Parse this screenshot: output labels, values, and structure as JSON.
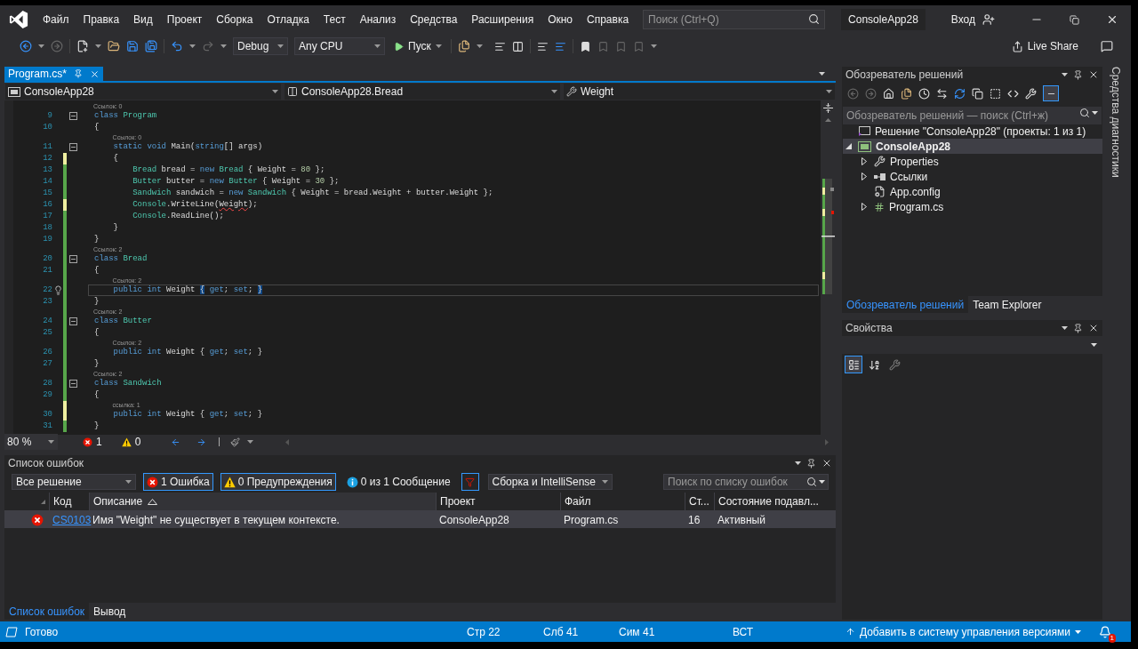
{
  "window": {
    "title": "ConsoleApp28",
    "search_placeholder": "Поиск (Ctrl+Q)",
    "sign_in": "Вход"
  },
  "menu": [
    "Файл",
    "Правка",
    "Вид",
    "Проект",
    "Сборка",
    "Отладка",
    "Тест",
    "Анализ",
    "Средства",
    "Расширения",
    "Окно",
    "Справка"
  ],
  "toolbar": {
    "configuration": "Debug",
    "platform": "Any CPU",
    "start": "Пуск",
    "live_share": "Live Share"
  },
  "editor": {
    "tabs": [
      {
        "label": "Program.cs*",
        "selected": true
      }
    ],
    "nav": [
      "ConsoleApp28",
      "ConsoleApp28.Bread",
      "Weight"
    ],
    "lines": [
      {
        "num": "9",
        "lens": "Ссылок: 0",
        "fold": true,
        "kind": "unchanged",
        "current": false,
        "lightbulb": false,
        "tokens": [
          {
            "t": "class ",
            "kind": "keyword"
          },
          {
            "t": "Program",
            "kind": "type"
          }
        ]
      },
      {
        "num": "10",
        "fold": false,
        "kind": "unchanged",
        "current": false,
        "lightbulb": false,
        "tokens": [
          {
            "t": "{",
            "kind": "text"
          }
        ]
      },
      {
        "num": "11",
        "lens": "Ссылок: 0",
        "fold": true,
        "kind": "unchanged",
        "current": false,
        "lightbulb": false,
        "tokens": [
          {
            "t": "    static ",
            "kind": "keyword"
          },
          {
            "t": "void",
            "kind": "keyword"
          },
          {
            "t": " Main(",
            "kind": "text"
          },
          {
            "t": "string",
            "kind": "keyword"
          },
          {
            "t": "[] args)",
            "kind": "text"
          }
        ]
      },
      {
        "num": "12",
        "fold": false,
        "kind": "unsaved",
        "current": false,
        "lightbulb": false,
        "tokens": [
          {
            "t": "    {",
            "kind": "text"
          }
        ]
      },
      {
        "num": "13",
        "fold": false,
        "kind": "saved",
        "current": false,
        "lightbulb": false,
        "tokens": [
          {
            "t": "        Bread",
            "kind": "type"
          },
          {
            "t": " bread = ",
            "kind": "text"
          },
          {
            "t": "new ",
            "kind": "keyword"
          },
          {
            "t": "Bread",
            "kind": "type"
          },
          {
            "t": " { Weight = ",
            "kind": "text"
          },
          {
            "t": "80",
            "kind": "number"
          },
          {
            "t": " };",
            "kind": "text"
          }
        ]
      },
      {
        "num": "14",
        "fold": false,
        "kind": "saved",
        "current": false,
        "lightbulb": false,
        "tokens": [
          {
            "t": "        Butter",
            "kind": "type"
          },
          {
            "t": " butter = ",
            "kind": "text"
          },
          {
            "t": "new ",
            "kind": "keyword"
          },
          {
            "t": "Butter",
            "kind": "type"
          },
          {
            "t": " { Weight = ",
            "kind": "text"
          },
          {
            "t": "30",
            "kind": "number"
          },
          {
            "t": " };",
            "kind": "text"
          }
        ]
      },
      {
        "num": "15",
        "fold": false,
        "kind": "saved",
        "current": false,
        "lightbulb": false,
        "tokens": [
          {
            "t": "        Sandwich",
            "kind": "type"
          },
          {
            "t": " sandwich = ",
            "kind": "text"
          },
          {
            "t": "new ",
            "kind": "keyword"
          },
          {
            "t": "Sandwich",
            "kind": "type"
          },
          {
            "t": " { Weight = bread.Weight + butter.Weight };",
            "kind": "text"
          }
        ]
      },
      {
        "num": "16",
        "fold": false,
        "kind": "unsaved",
        "current": false,
        "lightbulb": false,
        "tokens": [
          {
            "t": "        Console",
            "kind": "type"
          },
          {
            "t": ".WriteLine(",
            "kind": "text"
          },
          {
            "t": "Weight",
            "kind": "text",
            "error": true
          },
          {
            "t": ");",
            "kind": "text"
          }
        ]
      },
      {
        "num": "17",
        "fold": false,
        "kind": "saved",
        "current": false,
        "lightbulb": false,
        "tokens": [
          {
            "t": "        Console",
            "kind": "type"
          },
          {
            "t": ".ReadLine();",
            "kind": "text"
          }
        ]
      },
      {
        "num": "18",
        "fold": false,
        "kind": "saved",
        "current": false,
        "lightbulb": false,
        "tokens": [
          {
            "t": "    }",
            "kind": "text"
          }
        ]
      },
      {
        "num": "19",
        "fold": false,
        "kind": "saved",
        "current": false,
        "lightbulb": false,
        "tokens": [
          {
            "t": "}",
            "kind": "text"
          }
        ]
      },
      {
        "num": "20",
        "lens": "Ссылок: 2",
        "fold": true,
        "kind": "saved",
        "current": false,
        "lightbulb": false,
        "tokens": [
          {
            "t": "class ",
            "kind": "keyword"
          },
          {
            "t": "Bread",
            "kind": "type"
          }
        ]
      },
      {
        "num": "21",
        "fold": false,
        "kind": "saved",
        "current": false,
        "lightbulb": false,
        "tokens": [
          {
            "t": "{",
            "kind": "text"
          }
        ]
      },
      {
        "num": "22",
        "lens": "Ссылок: 2",
        "fold": false,
        "kind": "saved",
        "current": true,
        "lightbulb": true,
        "tokens": [
          {
            "t": "    public ",
            "kind": "keyword"
          },
          {
            "t": "int",
            "kind": "keyword"
          },
          {
            "t": " Weight ",
            "kind": "text"
          },
          {
            "t": "{",
            "kind": "text",
            "match": true
          },
          {
            "t": " get",
            "kind": "keyword"
          },
          {
            "t": "; ",
            "kind": "text"
          },
          {
            "t": "set",
            "kind": "keyword"
          },
          {
            "t": "; ",
            "kind": "text"
          },
          {
            "t": "}",
            "kind": "text",
            "match": true
          }
        ]
      },
      {
        "num": "23",
        "fold": false,
        "kind": "saved",
        "current": false,
        "lightbulb": false,
        "tokens": [
          {
            "t": "}",
            "kind": "text"
          }
        ]
      },
      {
        "num": "24",
        "lens": "Ссылок: 2",
        "fold": true,
        "kind": "saved",
        "current": false,
        "lightbulb": false,
        "tokens": [
          {
            "t": "class ",
            "kind": "keyword"
          },
          {
            "t": "Butter",
            "kind": "type"
          }
        ]
      },
      {
        "num": "25",
        "fold": false,
        "kind": "saved",
        "current": false,
        "lightbulb": false,
        "tokens": [
          {
            "t": "{",
            "kind": "text"
          }
        ]
      },
      {
        "num": "26",
        "lens": "Ссылок: 2",
        "fold": false,
        "kind": "saved",
        "current": false,
        "lightbulb": false,
        "tokens": [
          {
            "t": "    public ",
            "kind": "keyword"
          },
          {
            "t": "int",
            "kind": "keyword"
          },
          {
            "t": " Weight { ",
            "kind": "text"
          },
          {
            "t": "get",
            "kind": "keyword"
          },
          {
            "t": "; ",
            "kind": "text"
          },
          {
            "t": "set",
            "kind": "keyword"
          },
          {
            "t": "; }",
            "kind": "text"
          }
        ]
      },
      {
        "num": "27",
        "fold": false,
        "kind": "saved",
        "current": false,
        "lightbulb": false,
        "tokens": [
          {
            "t": "}",
            "kind": "text"
          }
        ]
      },
      {
        "num": "28",
        "lens": "Ссылок: 2",
        "fold": true,
        "kind": "saved",
        "current": false,
        "lightbulb": false,
        "tokens": [
          {
            "t": "class ",
            "kind": "keyword"
          },
          {
            "t": "Sandwich",
            "kind": "type"
          }
        ]
      },
      {
        "num": "29",
        "fold": false,
        "kind": "saved",
        "current": false,
        "lightbulb": false,
        "tokens": [
          {
            "t": "{",
            "kind": "text"
          }
        ]
      },
      {
        "num": "30",
        "lens": "ссылка: 1",
        "fold": false,
        "kind": "unsaved",
        "current": false,
        "lightbulb": false,
        "tokens": [
          {
            "t": "    public ",
            "kind": "keyword"
          },
          {
            "t": "int",
            "kind": "keyword"
          },
          {
            "t": " Weight { ",
            "kind": "text"
          },
          {
            "t": "get",
            "kind": "keyword"
          },
          {
            "t": "; ",
            "kind": "text"
          },
          {
            "t": "set",
            "kind": "keyword"
          },
          {
            "t": "; }",
            "kind": "text"
          }
        ]
      },
      {
        "num": "31",
        "fold": false,
        "kind": "saved",
        "current": false,
        "lightbulb": false,
        "tokens": [
          {
            "t": "}",
            "kind": "text"
          }
        ]
      }
    ],
    "zoom": "80 %",
    "errors": "1",
    "warnings": "0"
  },
  "error_list": {
    "title": "Список ошибок",
    "scope": "Все решение",
    "filters": [
      {
        "kind": "error",
        "label": "1 Ошибка",
        "selected": true
      },
      {
        "kind": "warning",
        "label": "0 Предупреждения",
        "selected": true
      },
      {
        "kind": "message",
        "label": "0 из 1 Сообщение",
        "selected": false
      }
    ],
    "build_filter": "Сборка и IntelliSense",
    "search_placeholder": "Поиск по списку ошибок",
    "columns": [
      {
        "label": "Код",
        "sorted": false
      },
      {
        "label": "Описание",
        "sorted": true
      },
      {
        "label": "Проект",
        "sorted": false
      },
      {
        "label": "Файл",
        "sorted": false
      },
      {
        "label": "Ст...",
        "sorted": false
      },
      {
        "label": "Состояние подавл...",
        "sorted": false
      }
    ],
    "rows": [
      {
        "kind": "error",
        "code": "CS0103",
        "description": "Имя \"Weight\" не существует в текущем контексте.",
        "project": "ConsoleApp28",
        "file": "Program.cs",
        "line": "16",
        "state": "Активный",
        "selected": true
      }
    ],
    "tabs": [
      {
        "label": "Список ошибок",
        "selected": true
      },
      {
        "label": "Вывод",
        "selected": false
      }
    ]
  },
  "solution_explorer": {
    "title": "Обозреватель решений",
    "search_placeholder": "Обозреватель решений — поиск (Ctrl+ж)",
    "tree": [
      {
        "label": "Решение \"ConsoleApp28\" (проекты: 1 из 1)",
        "kind": "solution",
        "selected": false,
        "startup": false,
        "children": [
          {
            "label": "ConsoleApp28",
            "kind": "csproject",
            "selected": true,
            "startup": true,
            "expanded": true,
            "children": [
              {
                "label": "Properties",
                "kind": "properties",
                "selected": false,
                "startup": false,
                "expanded": false
              },
              {
                "label": "Ссылки",
                "kind": "references",
                "selected": false,
                "startup": false,
                "expanded": false
              },
              {
                "label": "App.config",
                "kind": "config",
                "selected": false,
                "startup": false
              },
              {
                "label": "Program.cs",
                "kind": "csfile",
                "selected": false,
                "startup": false,
                "expanded": false
              }
            ]
          }
        ]
      }
    ],
    "tabs": [
      {
        "label": "Обозреватель решений",
        "selected": true
      },
      {
        "label": "Team Explorer",
        "selected": false
      }
    ]
  },
  "properties": {
    "title": "Свойства",
    "tools": [
      {
        "kind": "categorized",
        "selected": true
      },
      {
        "kind": "alphabetical",
        "selected": false
      },
      {
        "kind": "pages",
        "selected": false
      }
    ]
  },
  "side_tab": "Средства диагностики",
  "status_bar": {
    "status": "Готово",
    "line": "Стр 22",
    "column": "Слб 41",
    "char": "Сим 41",
    "mode": "ВСТ",
    "source_control": "Добавить в систему управления версиями",
    "notifications": "1"
  }
}
